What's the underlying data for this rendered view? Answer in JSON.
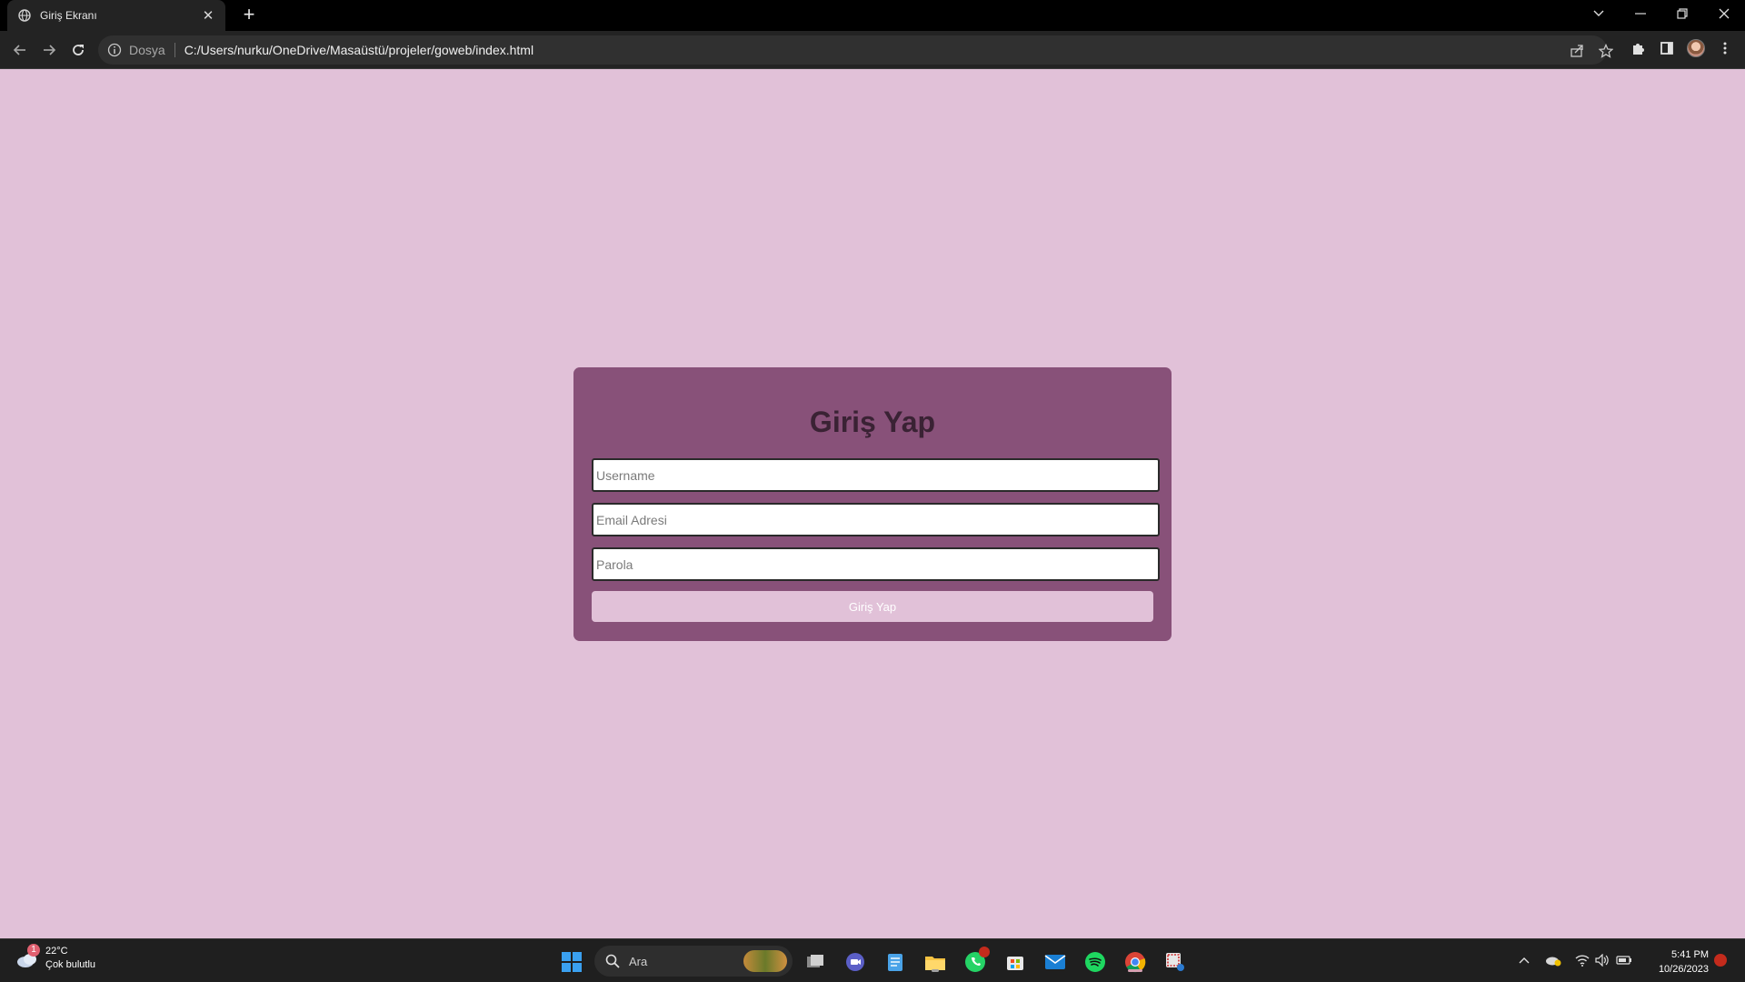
{
  "browser": {
    "tab_title": "Giriş Ekranı",
    "scheme_label": "Dosya",
    "url": "C:/Users/nurku/OneDrive/Masaüstü/projeler/goweb/index.html"
  },
  "page": {
    "background_color": "#e1c1d8",
    "card_color": "#885179",
    "title": "Giriş Yap",
    "username_placeholder": "Username",
    "email_placeholder": "Email Adresi",
    "password_placeholder": "Parola",
    "submit_label": "Giriş Yap"
  },
  "taskbar": {
    "weather_temp": "22°C",
    "weather_desc": "Çok bulutlu",
    "weather_badge": "1",
    "search_label": "Ara",
    "time": "5:41 PM",
    "date": "10/26/2023",
    "icons": [
      "windows-start-icon",
      "search-icon",
      "task-view-icon",
      "teams-icon",
      "notepad-icon",
      "file-explorer-icon",
      "whatsapp-icon",
      "store-icon",
      "mail-icon",
      "spotify-icon",
      "chrome-icon",
      "snipping-tool-icon"
    ]
  }
}
